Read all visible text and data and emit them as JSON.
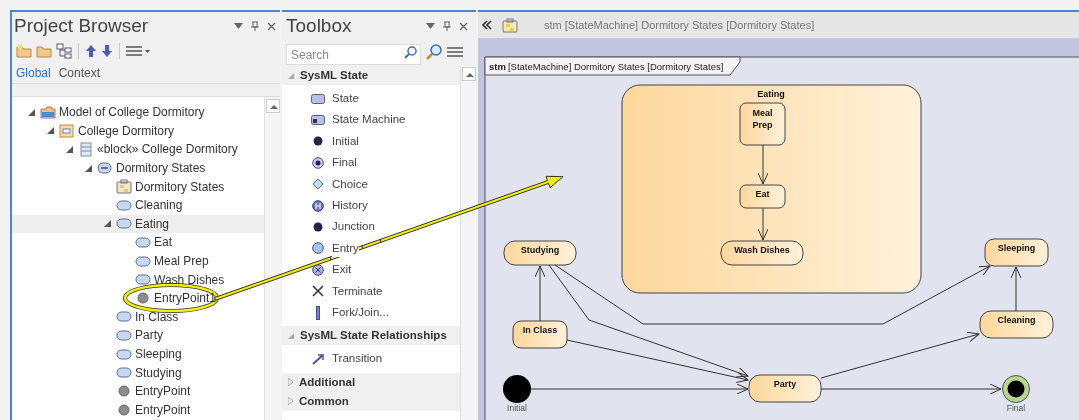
{
  "project_browser": {
    "title": "Project Browser",
    "tabs": [
      {
        "label": "Global",
        "selected": true
      },
      {
        "label": "Context",
        "selected": false
      }
    ],
    "tree": [
      {
        "label": "Model of College Dormitory",
        "kind": "package",
        "expanded": true,
        "selected": false,
        "children": [
          {
            "label": "College Dormitory",
            "kind": "class",
            "expanded": true,
            "selected": false,
            "children": [
              {
                "label": "«block» College Dormitory",
                "kind": "block",
                "expanded": true,
                "selected": false,
                "children": [
                  {
                    "label": "Dormitory States",
                    "kind": "statemachine",
                    "expanded": true,
                    "selected": false,
                    "children": [
                      {
                        "label": "Dormitory States",
                        "kind": "diagram",
                        "selected": false
                      },
                      {
                        "label": "Cleaning",
                        "kind": "state",
                        "selected": false
                      },
                      {
                        "label": "Eating",
                        "kind": "state",
                        "expanded": true,
                        "selected": true,
                        "children": [
                          {
                            "label": "Eat",
                            "kind": "state",
                            "selected": false
                          },
                          {
                            "label": "Meal Prep",
                            "kind": "state",
                            "selected": false
                          },
                          {
                            "label": "Wash Dishes",
                            "kind": "state",
                            "selected": false
                          },
                          {
                            "label": "EntryPoint1",
                            "kind": "entrypoint",
                            "selected": false
                          }
                        ]
                      },
                      {
                        "label": "In Class",
                        "kind": "state",
                        "selected": false
                      },
                      {
                        "label": "Party",
                        "kind": "state",
                        "selected": false
                      },
                      {
                        "label": "Sleeping",
                        "kind": "state",
                        "selected": false
                      },
                      {
                        "label": "Studying",
                        "kind": "state",
                        "selected": false
                      },
                      {
                        "label": "EntryPoint",
                        "kind": "entrypoint",
                        "selected": false
                      },
                      {
                        "label": "EntryPoint",
                        "kind": "entrypoint",
                        "selected": false
                      }
                    ]
                  }
                ]
              }
            ]
          }
        ]
      }
    ]
  },
  "toolbox": {
    "title": "Toolbox",
    "search": {
      "placeholder": "Search"
    },
    "sections": [
      {
        "title": "SysML State",
        "expanded": true,
        "items": [
          {
            "label": "State",
            "kind": "state"
          },
          {
            "label": "State Machine",
            "kind": "statemachine"
          },
          {
            "label": "Initial",
            "kind": "initial"
          },
          {
            "label": "Final",
            "kind": "final"
          },
          {
            "label": "Choice",
            "kind": "choice"
          },
          {
            "label": "History",
            "kind": "history"
          },
          {
            "label": "Junction",
            "kind": "junction"
          },
          {
            "label": "Entry",
            "kind": "entry"
          },
          {
            "label": "Exit",
            "kind": "exit"
          },
          {
            "label": "Terminate",
            "kind": "terminate"
          },
          {
            "label": "Fork/Join...",
            "kind": "fork"
          }
        ]
      },
      {
        "title": "SysML State Relationships",
        "expanded": true,
        "items": [
          {
            "label": "Transition",
            "kind": "transition"
          }
        ]
      },
      {
        "title": "Additional",
        "expanded": false
      },
      {
        "title": "Common",
        "expanded": false
      }
    ]
  },
  "diagram": {
    "tab_title": "stm [StateMachine] Dormitory States [Dormitory States]",
    "frame": {
      "keyword": "stm",
      "title": "[StateMachine] Dormitory States [Dormitory States]"
    },
    "composite": {
      "name": "Eating",
      "substates": [
        "Meal Prep",
        "Eat",
        "Wash Dishes"
      ]
    },
    "states": [
      "Studying",
      "In Class",
      "Sleeping",
      "Cleaning",
      "Party"
    ],
    "pseudostates": [
      {
        "kind": "initial",
        "label": "Initial"
      },
      {
        "kind": "final",
        "label": "Final"
      }
    ]
  }
}
